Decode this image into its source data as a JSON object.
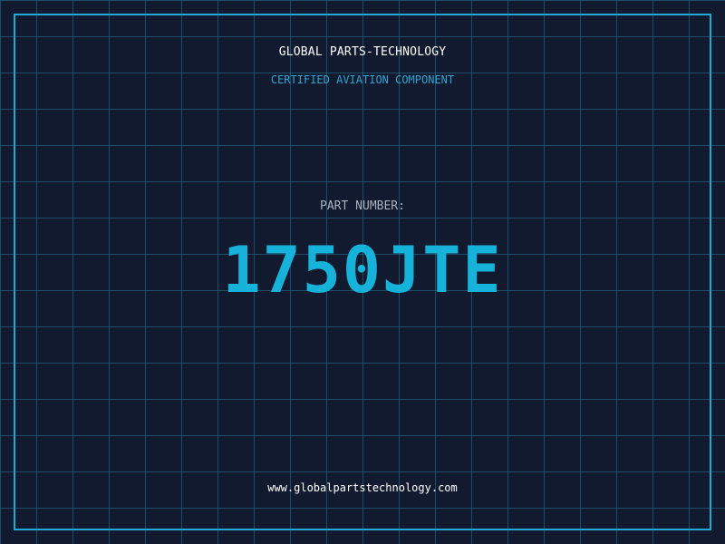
{
  "header": {
    "company_name": "GLOBAL PARTS-TECHNOLOGY",
    "tagline": "CERTIFIED AVIATION COMPONENT"
  },
  "part": {
    "label": "PART NUMBER:",
    "number": "1750JTE"
  },
  "footer": {
    "website": "www.globalpartstechnology.com"
  },
  "colors": {
    "background": "#111a2e",
    "grid": "#26788f",
    "border": "#1faad6",
    "accent": "#17b2d9",
    "label": "#a9b2bf",
    "text": "#ffffff"
  }
}
